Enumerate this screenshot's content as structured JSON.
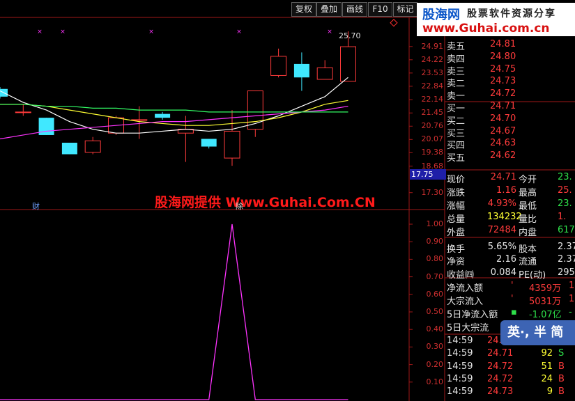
{
  "toolbar": {
    "buttons": [
      "复权",
      "叠加",
      "画线",
      "F10",
      "标记"
    ]
  },
  "logo": {
    "brand": "股海网",
    "slogan": "股票软件资源分享",
    "url": "www.Guhai.com.cn"
  },
  "watermark": "股海网提供 Www.Guhai.Com.CN",
  "price_chart": {
    "max_label": "25.70",
    "current_price_tag": "17.75",
    "y_ticks": [
      "24.91",
      "24.22",
      "23.53",
      "22.84",
      "22.14",
      "21.45",
      "20.76",
      "20.07",
      "19.38",
      "18.68",
      "17.30"
    ],
    "lower_labels": [
      "财",
      "除"
    ],
    "candles": [
      {
        "o": 22.7,
        "c": 22.3,
        "h": 22.8,
        "l": 22.2
      },
      {
        "o": 21.5,
        "c": 21.5,
        "h": 21.9,
        "l": 21.3
      },
      {
        "o": 21.2,
        "c": 20.3,
        "h": 21.2,
        "l": 20.3
      },
      {
        "o": 19.9,
        "c": 19.3,
        "h": 19.9,
        "l": 19.3
      },
      {
        "o": 19.4,
        "c": 20.0,
        "h": 20.2,
        "l": 19.3
      },
      {
        "o": 20.4,
        "c": 21.2,
        "h": 21.3,
        "l": 20.3
      },
      {
        "o": 21.1,
        "c": 21.1,
        "h": 21.8,
        "l": 20.1
      },
      {
        "o": 21.4,
        "c": 21.2,
        "h": 21.5,
        "l": 21.1
      },
      {
        "o": 20.4,
        "c": 20.6,
        "h": 21.3,
        "l": 18.9
      },
      {
        "o": 20.1,
        "c": 19.7,
        "h": 20.1,
        "l": 19.6
      },
      {
        "o": 19.1,
        "c": 20.5,
        "h": 21.6,
        "l": 18.7
      },
      {
        "o": 20.6,
        "c": 22.6,
        "h": 22.6,
        "l": 20.2
      },
      {
        "o": 23.4,
        "c": 24.4,
        "h": 24.8,
        "l": 23.3
      },
      {
        "o": 24.0,
        "c": 23.3,
        "h": 24.6,
        "l": 22.6
      },
      {
        "o": 23.2,
        "c": 23.8,
        "h": 24.2,
        "l": 23.2
      },
      {
        "o": 23.1,
        "c": 24.9,
        "h": 25.7,
        "l": 23.1
      }
    ],
    "ma_series": [
      {
        "color": "#ffffff",
        "values": [
          22.6,
          22.0,
          21.6,
          21.0,
          20.6,
          20.4,
          20.4,
          20.5,
          20.6,
          20.5,
          20.6,
          20.9,
          21.3,
          21.8,
          22.3,
          23.3
        ]
      },
      {
        "color": "#ffff33",
        "values": [
          21.9,
          21.9,
          21.8,
          21.6,
          21.4,
          21.2,
          21.0,
          20.9,
          20.8,
          20.8,
          20.9,
          21.0,
          21.2,
          21.5,
          21.9,
          22.1
        ]
      },
      {
        "color": "#ff33ff",
        "values": [
          20.1,
          20.3,
          20.5,
          20.6,
          20.7,
          20.8,
          20.9,
          21.0,
          21.0,
          21.1,
          21.2,
          21.3,
          21.4,
          21.5,
          21.6,
          21.8
        ]
      },
      {
        "color": "#33ff66",
        "values": [
          21.9,
          21.9,
          21.8,
          21.8,
          21.7,
          21.7,
          21.6,
          21.6,
          21.6,
          21.5,
          21.5,
          21.5,
          21.5,
          21.5,
          21.5,
          21.5
        ]
      }
    ]
  },
  "signal_chart": {
    "y_ticks": [
      "1.00",
      "0.90",
      "0.80",
      "0.70",
      "0.60",
      "0.50",
      "0.40",
      "0.30",
      "0.20",
      "0.10"
    ],
    "values": [
      0,
      0,
      0,
      0,
      0,
      0,
      0,
      0,
      0,
      0,
      1,
      0,
      0,
      0,
      0,
      0
    ]
  },
  "order_book": [
    {
      "label": "卖五",
      "price": "24.81",
      "cls": "red"
    },
    {
      "label": "卖四",
      "price": "24.80",
      "cls": "red"
    },
    {
      "label": "卖三",
      "price": "24.75",
      "cls": "red"
    },
    {
      "label": "卖二",
      "price": "24.73",
      "cls": "red"
    },
    {
      "label": "卖一",
      "price": "24.72",
      "cls": "red"
    },
    {
      "label": "买一",
      "price": "24.71",
      "cls": "red"
    },
    {
      "label": "买二",
      "price": "24.70",
      "cls": "red"
    },
    {
      "label": "买三",
      "price": "24.67",
      "cls": "red"
    },
    {
      "label": "买四",
      "price": "24.63",
      "cls": "red"
    },
    {
      "label": "买五",
      "price": "24.62",
      "cls": "red"
    }
  ],
  "quote": [
    {
      "l1": "现价",
      "v1": "24.71",
      "c1": "red",
      "l2": "今开",
      "v2": "23.",
      "c2": "green"
    },
    {
      "l1": "涨跌",
      "v1": "1.16",
      "c1": "red",
      "l2": "最高",
      "v2": "25.",
      "c2": "red"
    },
    {
      "l1": "涨幅",
      "v1": "4.93%",
      "c1": "red",
      "l2": "最低",
      "v2": "23.",
      "c2": "green"
    },
    {
      "l1": "总量",
      "v1": "134232",
      "c1": "yellow",
      "l2": "量比",
      "v2": "1.",
      "c2": "red"
    },
    {
      "l1": "外盘",
      "v1": "72484",
      "c1": "red",
      "l2": "内盘",
      "v2": "617",
      "c2": "green"
    },
    {
      "l1": "换手",
      "v1": "5.65%",
      "c1": "white",
      "l2": "股本",
      "v2": "2.37",
      "c2": "white"
    },
    {
      "l1": "净资",
      "v1": "2.16",
      "c1": "white",
      "l2": "流通",
      "v2": "2.37",
      "c2": "white"
    },
    {
      "l1": "收益㈣",
      "v1": "0.084",
      "c1": "white",
      "l2": "PE(动)",
      "v2": "295",
      "c2": "white"
    }
  ],
  "flows": [
    {
      "label": "净流入额",
      "mark": "'",
      "value": "4359万",
      "cls": "red",
      "tail": "1"
    },
    {
      "label": "大宗流入",
      "mark": "'",
      "value": "5031万",
      "cls": "red",
      "tail": "1"
    },
    {
      "label": "5日净流入额",
      "mark": "▪",
      "value": "-1.07亿",
      "cls": "green",
      "tail": "-"
    },
    {
      "label": "5日大宗流",
      "mark": "",
      "value": "",
      "cls": "green",
      "tail": ""
    }
  ],
  "ime": "英·, 半 简",
  "ticks": [
    {
      "time": "14:59",
      "price": "24.7",
      "vol": "",
      "side": ""
    },
    {
      "time": "14:59",
      "price": "24.71",
      "vol": "92",
      "side": "S",
      "scls": "green"
    },
    {
      "time": "14:59",
      "price": "24.72",
      "vol": "51",
      "side": "B",
      "scls": "red"
    },
    {
      "time": "14:59",
      "price": "24.72",
      "vol": "24",
      "side": "B",
      "scls": "red"
    },
    {
      "time": "14:59",
      "price": "24.73",
      "vol": "9",
      "side": "B",
      "scls": "red"
    }
  ]
}
